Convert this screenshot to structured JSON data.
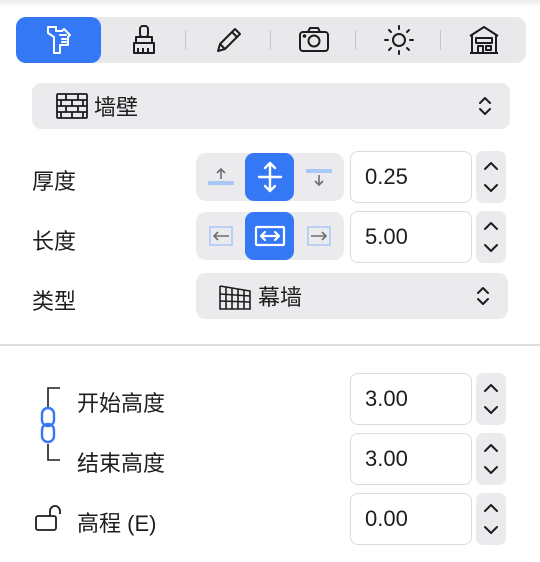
{
  "toolbar": {
    "tabs": [
      {
        "id": "properties",
        "icon": "building-properties-icon",
        "active": true
      },
      {
        "id": "style",
        "icon": "brush-icon",
        "active": false
      },
      {
        "id": "edit",
        "icon": "pencil-icon",
        "active": false
      },
      {
        "id": "camera",
        "icon": "camera-icon",
        "active": false
      },
      {
        "id": "lighting",
        "icon": "sun-icon",
        "active": false
      },
      {
        "id": "building",
        "icon": "house-icon",
        "active": false
      }
    ],
    "accent_color": "#3478f6"
  },
  "object_type": {
    "label": "墙壁",
    "icon": "brick-wall-icon"
  },
  "thickness": {
    "label": "厚度",
    "value": "0.25",
    "align_options": [
      "top",
      "center",
      "bottom"
    ],
    "selected": "center"
  },
  "length": {
    "label": "长度",
    "value": "5.00",
    "align_options": [
      "left",
      "center",
      "right"
    ],
    "selected": "center"
  },
  "type": {
    "label": "类型",
    "value": "幕墙",
    "icon": "curtain-wall-icon"
  },
  "start_height": {
    "label": "开始高度",
    "value": "3.00"
  },
  "end_height": {
    "label": "结束高度",
    "value": "3.00"
  },
  "height_link": {
    "icon": "chain-link-icon",
    "linked": true
  },
  "elevation": {
    "label": "高程 (E)",
    "value": "0.00",
    "icon": "unlocked-padlock-icon"
  }
}
